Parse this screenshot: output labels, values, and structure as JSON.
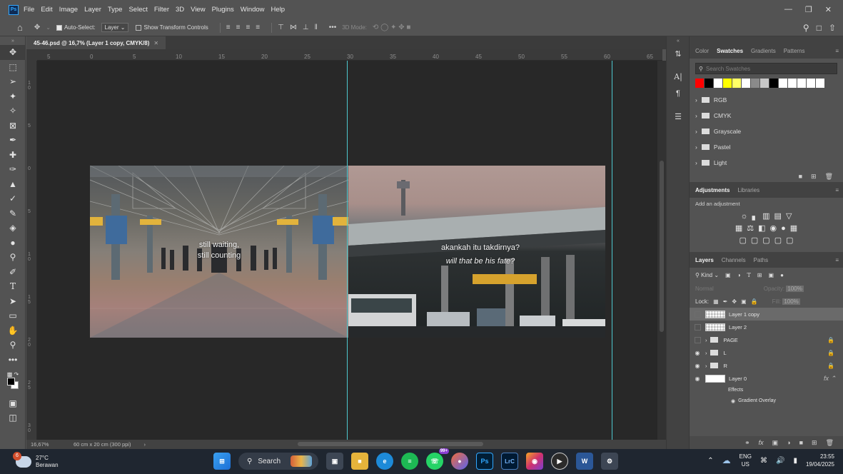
{
  "menubar": {
    "logo": "Ps",
    "items": [
      "File",
      "Edit",
      "Image",
      "Layer",
      "Type",
      "Select",
      "Filter",
      "3D",
      "View",
      "Plugins",
      "Window",
      "Help"
    ]
  },
  "options": {
    "auto_select_label": "Auto-Select:",
    "auto_select_value": "Layer",
    "transform_label": "Show Transform Controls",
    "mode_label": "3D Mode:"
  },
  "document": {
    "tab_title": "45-46.psd @ 16,7% (Layer 1 copy, CMYK/8)",
    "ruler_h": [
      "5",
      "0",
      "5",
      "10",
      "15",
      "20",
      "25",
      "30",
      "35",
      "40",
      "45",
      "50",
      "55",
      "60",
      "65"
    ],
    "ruler_v": [
      "1\n0",
      "5",
      "0",
      "5",
      "1\n0",
      "1\n5",
      "2\n0",
      "2\n5",
      "3\n0"
    ],
    "left_caption_1": "still waiting,",
    "left_caption_2": "still counting",
    "right_caption_1": "akankah itu takdirnya?",
    "right_caption_2": "will that be his fate?"
  },
  "status": {
    "zoom": "16,67%",
    "doc_size": "60 cm x 20 cm (300 ppi)"
  },
  "swatches_panel": {
    "tabs": [
      "Color",
      "Swatches",
      "Gradients",
      "Patterns"
    ],
    "active_tab": "Swatches",
    "search_placeholder": "Search Swatches",
    "colors": [
      "#ff0000",
      "#000000",
      "#ffffff",
      "#ffff00",
      "#ffff66",
      "#ffffff",
      "#8a8a8a",
      "#c8c8c8",
      "#000000",
      "#ffffff",
      "#ffffff",
      "#ffffff",
      "#ffffff",
      "#ffffff"
    ],
    "folders": [
      "RGB",
      "CMYK",
      "Grayscale",
      "Pastel",
      "Light"
    ]
  },
  "adjustments_panel": {
    "tabs": [
      "Adjustments",
      "Libraries"
    ],
    "add_label": "Add an adjustment"
  },
  "layers_panel": {
    "tabs": [
      "Layers",
      "Channels",
      "Paths"
    ],
    "filter_label": "Kind",
    "blend_mode": "Normal",
    "opacity_label": "Opacity:",
    "opacity_value": "100%",
    "lock_label": "Lock:",
    "fill_label": "Fill:",
    "fill_value": "100%",
    "layers": [
      {
        "name": "Layer 1 copy"
      },
      {
        "name": "Layer 2"
      },
      {
        "name": "PAGE"
      },
      {
        "name": "L"
      },
      {
        "name": "R"
      },
      {
        "name": "Layer 0"
      }
    ],
    "effects_label": "Effects",
    "effect_item": "Gradient Overlay"
  },
  "taskbar": {
    "weather_temp": "27°C",
    "weather_desc": "Berawan",
    "weather_badge": "6",
    "search_label": "Search",
    "lang_1": "ENG",
    "lang_2": "US",
    "time": "23:55",
    "date": "19/04/2025",
    "app_labels": [
      "Ps",
      "LrC"
    ],
    "badge": "99+"
  },
  "colors": {
    "guide": "#4ec8cf",
    "ps_blue": "#31a8ff",
    "canvas_bg": "#282828"
  }
}
